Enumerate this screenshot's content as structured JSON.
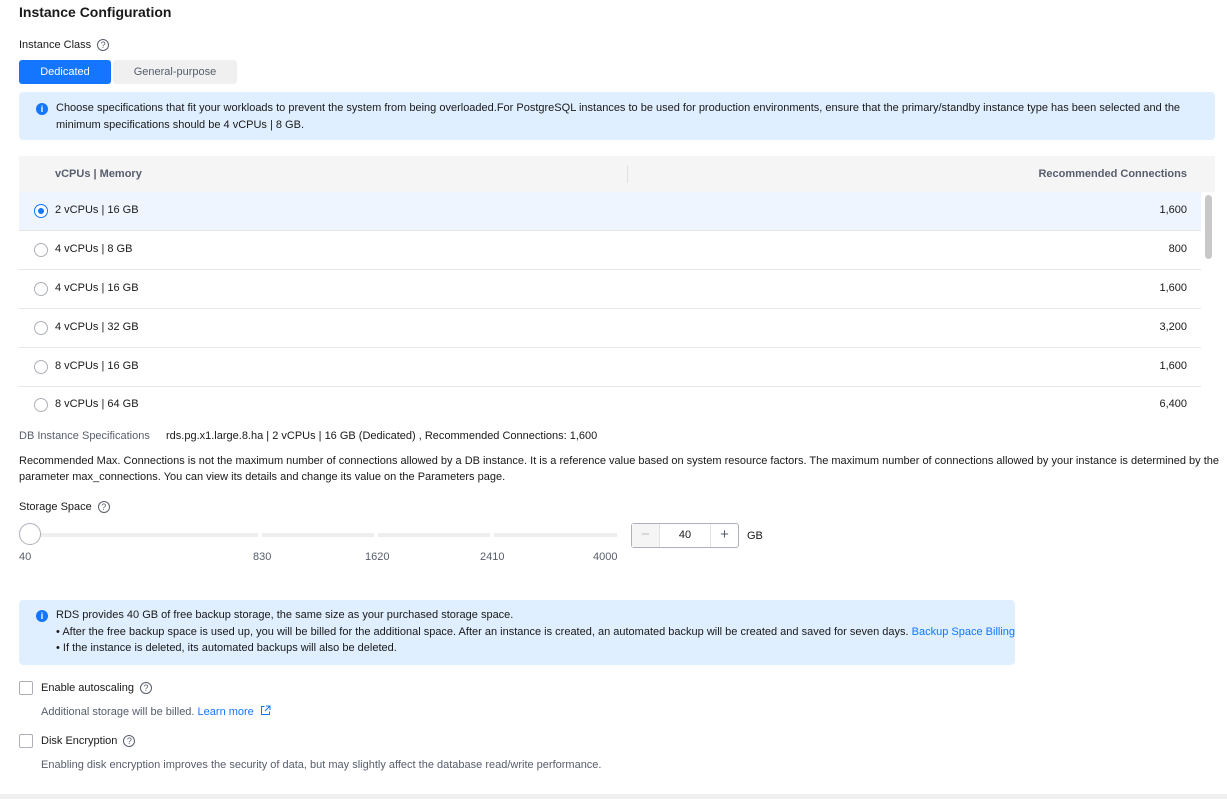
{
  "section_title": "Instance Configuration",
  "instance_class": {
    "label": "Instance Class",
    "options": [
      "Dedicated",
      "General-purpose"
    ],
    "selected": "Dedicated"
  },
  "spec_info": {
    "line1": "Choose specifications that fit your workloads to prevent the system from being overloaded.For PostgreSQL instances to be used for production environments, ensure that the primary/standby instance type has been selected and the",
    "line2": "minimum specifications should be 4 vCPUs | 8 GB."
  },
  "spec_table": {
    "columns": [
      "vCPUs | Memory",
      "Recommended Connections"
    ],
    "rows": [
      {
        "spec": "2 vCPUs | 16 GB",
        "connections": "1,600",
        "selected": true
      },
      {
        "spec": "4 vCPUs | 8 GB",
        "connections": "800",
        "selected": false
      },
      {
        "spec": "4 vCPUs | 16 GB",
        "connections": "1,600",
        "selected": false
      },
      {
        "spec": "4 vCPUs | 32 GB",
        "connections": "3,200",
        "selected": false
      },
      {
        "spec": "8 vCPUs | 16 GB",
        "connections": "1,600",
        "selected": false
      },
      {
        "spec": "8 vCPUs | 64 GB",
        "connections": "6,400",
        "selected": false
      }
    ]
  },
  "db_spec": {
    "label": "DB Instance Specifications",
    "value": "rds.pg.x1.large.8.ha | 2 vCPUs | 16 GB (Dedicated) , Recommended Connections: 1,600"
  },
  "connections_note": {
    "line1": "Recommended Max. Connections is not the maximum number of connections allowed by a DB instance. It is a reference value based on system resource factors. The maximum number of connections allowed by your instance is determined by the",
    "line2": "parameter max_connections. You can view its details and change its value on the Parameters page."
  },
  "storage": {
    "label": "Storage Space",
    "ticks": [
      "40",
      "830",
      "1620",
      "2410",
      "4000"
    ],
    "value": "40",
    "unit": "GB",
    "minus": "−",
    "plus": "+"
  },
  "backup_info": {
    "line1": "RDS provides 40 GB of free backup storage, the same size as your purchased storage space.",
    "bullet1": "After the free backup space is used up, you will be billed for the additional space. After an instance is created, an automated backup will be created and saved for seven days.",
    "bullet1_link": "Backup Space Billing",
    "bullet2": "If the instance is deleted, its automated backups will also be deleted."
  },
  "autoscaling": {
    "label": "Enable autoscaling",
    "note": "Additional storage will be billed.",
    "link": "Learn more"
  },
  "encryption": {
    "label": "Disk Encryption",
    "note": "Enabling disk encryption improves the security of data, but may slightly affect the database read/write performance."
  },
  "colors": {
    "accent": "#1476ff",
    "info_bg": "#e0efff",
    "selected_row": "#eef5ff"
  },
  "icons": [
    "help-icon",
    "info-icon",
    "external-link-icon"
  ]
}
